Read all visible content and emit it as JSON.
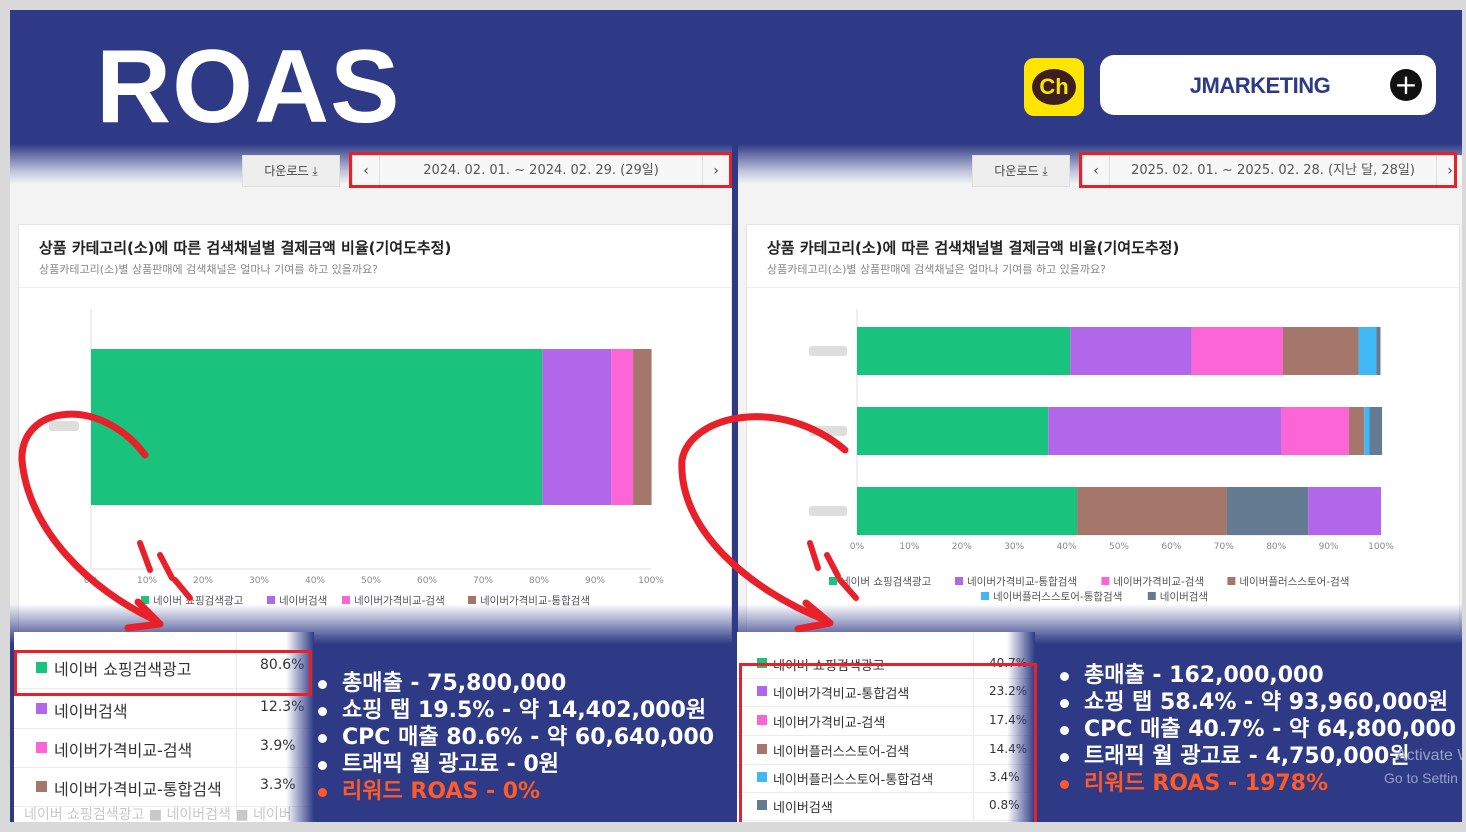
{
  "header": {
    "title": "ROAS",
    "channel_badge": "Ch",
    "brand": "JMARKETING",
    "add_icon": "plus-circle-icon",
    "colors": {
      "background": "#2e3a86",
      "badge": "#fde500",
      "highlight": "#e8202a",
      "reward": "#ff5a2a"
    }
  },
  "left": {
    "download_label": "다운로드 ⤓",
    "date_range": "2024. 02. 01. ~ 2024. 02. 29. (29일)",
    "panel_title": "상품 카테고리(소)에 따른 검색채널별 결제금액 비율(기여도추정)",
    "panel_subtitle": "상품카테고리(소)별 상품판매에 검색채널은 얼마나 기여를 하고 있을까요?",
    "table": [
      {
        "label": "네이버 쇼핑검색광고",
        "pct": "80.6%",
        "color": "#19c37d"
      },
      {
        "label": "네이버검색",
        "pct": "12.3%",
        "color": "#b266ea"
      },
      {
        "label": "네이버가격비교-검색",
        "pct": "3.9%",
        "color": "#fb65d6"
      },
      {
        "label": "네이버가격비교-통합검색",
        "pct": "3.3%",
        "color": "#a5766a"
      }
    ],
    "table_footer": "네이버 쇼핑검색광고 ■ 네이버검색 ■ 네이버",
    "bullets": [
      "총매출 - 75,800,000",
      "쇼핑 탭 19.5% - 약 14,402,000원",
      "CPC 매출 80.6% - 약 60,640,000",
      "트래픽 월 광고료 - 0원",
      "리워드 ROAS - 0%"
    ]
  },
  "right": {
    "download_label": "다운로드 ⤓",
    "date_range": "2025. 02. 01. ~ 2025. 02. 28. (지난 달, 28일)",
    "panel_title": "상품 카테고리(소)에 따른 검색채널별 결제금액 비율(기여도추정)",
    "panel_subtitle": "상품카테고리(소)별 상품판매에 검색채널은 얼마나 기여를 하고 있을까요?",
    "table": [
      {
        "label": "네이버 쇼핑검색광고",
        "pct": "40.7%",
        "color": "#19c37d"
      },
      {
        "label": "네이버가격비교-통합검색",
        "pct": "23.2%",
        "color": "#b266ea"
      },
      {
        "label": "네이버가격비교-검색",
        "pct": "17.4%",
        "color": "#fb65d6"
      },
      {
        "label": "네이버플러스스토어-검색",
        "pct": "14.4%",
        "color": "#a5766a"
      },
      {
        "label": "네이버플러스스토어-통합검색",
        "pct": "3.4%",
        "color": "#3fb8f5"
      },
      {
        "label": "네이버검색",
        "pct": "0.8%",
        "color": "#647b91"
      }
    ],
    "bullets": [
      "총매출 - 162,000,000",
      "쇼핑 탭 58.4% - 약 93,960,000원",
      "CPC 매출 40.7% - 약 64,800,000",
      "트래픽 월 광고료 - 4,750,000원",
      "리워드 ROAS - 1978%"
    ],
    "watermark_line1": "Activate W",
    "watermark_line2": "Go to Settin"
  },
  "chart_data": [
    {
      "type": "bar",
      "orientation": "horizontal",
      "stacked": true,
      "title": "상품 카테고리(소)에 따른 검색채널별 결제금액 비율(기여도추정)",
      "xlim": [
        0,
        100
      ],
      "xticks": [
        "0%",
        "10%",
        "20%",
        "30%",
        "40%",
        "50%",
        "60%",
        "70%",
        "80%",
        "90%",
        "100%"
      ],
      "legend_position": "bottom",
      "series": [
        {
          "name": "네이버 쇼핑검색광고",
          "color": "#19c37d",
          "values": [
            80.6
          ]
        },
        {
          "name": "네이버검색",
          "color": "#b266ea",
          "values": [
            12.3
          ]
        },
        {
          "name": "네이버가격비교-검색",
          "color": "#fb65d6",
          "values": [
            3.9
          ]
        },
        {
          "name": "네이버가격비교-통합검색",
          "color": "#a5766a",
          "values": [
            3.3
          ]
        }
      ]
    },
    {
      "type": "bar",
      "orientation": "horizontal",
      "stacked": true,
      "title": "상품 카테고리(소)에 따른 검색채널별 결제금액 비율(기여도추정)",
      "xlim": [
        0,
        100
      ],
      "xticks": [
        "0%",
        "10%",
        "20%",
        "30%",
        "40%",
        "50%",
        "60%",
        "70%",
        "80%",
        "90%",
        "100%"
      ],
      "legend_position": "bottom",
      "series": [
        {
          "name": "네이버 쇼핑검색광고",
          "color": "#19c37d",
          "values": [
            40.7,
            36.5,
            42
          ]
        },
        {
          "name": "네이버가격비교-통합검색",
          "color": "#b266ea",
          "values": [
            23.2,
            44.5,
            0
          ]
        },
        {
          "name": "네이버가격비교-검색",
          "color": "#fb65d6",
          "values": [
            17.4,
            12.9,
            0
          ]
        },
        {
          "name": "네이버플러스스토어-검색",
          "color": "#a5766a",
          "values": [
            14.4,
            2.9,
            28.6
          ]
        },
        {
          "name": "네이버플러스스토어-통합검색",
          "color": "#3fb8f5",
          "values": [
            3.4,
            1.0,
            0
          ]
        },
        {
          "name": "네이버검색",
          "color": "#647b91",
          "values": [
            0.8,
            2.4,
            15.5
          ]
        },
        {
          "name": "",
          "color": "#b266ea",
          "values": [
            0,
            0,
            13.9
          ]
        }
      ]
    }
  ]
}
